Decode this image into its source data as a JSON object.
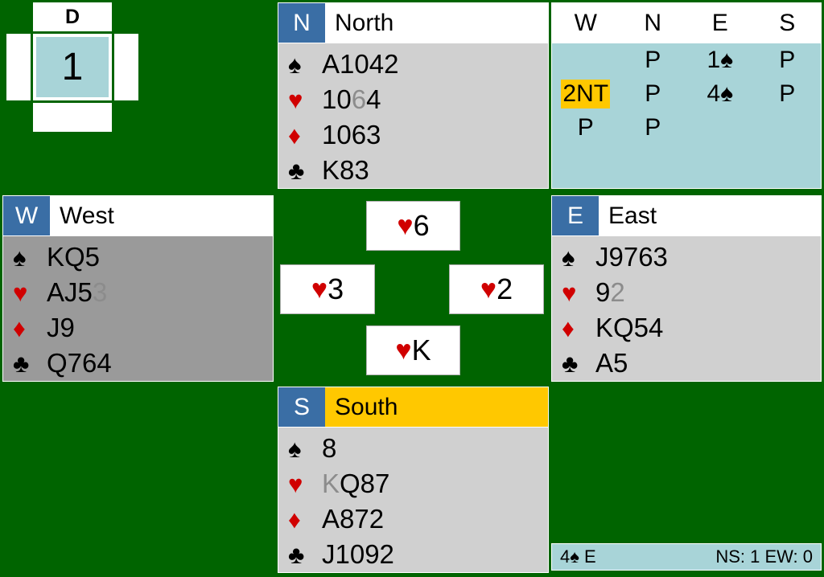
{
  "board": {
    "number": "1",
    "dealer_label": "D",
    "dealer_position": "north",
    "vulnerable": "none",
    "west_label": "",
    "east_label": "",
    "south_label": ""
  },
  "hands": {
    "north": {
      "direction": "N",
      "name": "North",
      "highlight": false,
      "active": false,
      "suits": [
        {
          "symbol": "♠",
          "color": "black",
          "cards": "A1042",
          "played_suffix": ""
        },
        {
          "symbol": "♥",
          "color": "red",
          "cards": "10",
          "played_mid": "6",
          "cards_tail": "4"
        },
        {
          "symbol": "♦",
          "color": "red",
          "cards": "1063",
          "played_suffix": ""
        },
        {
          "symbol": "♣",
          "color": "black",
          "cards": "K83",
          "played_suffix": ""
        }
      ]
    },
    "west": {
      "direction": "W",
      "name": "West",
      "highlight": false,
      "active": true,
      "suits": [
        {
          "symbol": "♠",
          "color": "black",
          "cards": "KQ5",
          "played_suffix": ""
        },
        {
          "symbol": "♥",
          "color": "red",
          "cards": "AJ5",
          "played_suffix": "3"
        },
        {
          "symbol": "♦",
          "color": "red",
          "cards": "J9",
          "played_suffix": ""
        },
        {
          "symbol": "♣",
          "color": "black",
          "cards": "Q764",
          "played_suffix": ""
        }
      ]
    },
    "east": {
      "direction": "E",
      "name": "East",
      "highlight": false,
      "active": false,
      "suits": [
        {
          "symbol": "♠",
          "color": "black",
          "cards": "J9763",
          "played_suffix": ""
        },
        {
          "symbol": "♥",
          "color": "red",
          "cards": "9",
          "played_suffix": "2"
        },
        {
          "symbol": "♦",
          "color": "red",
          "cards": "KQ54",
          "played_suffix": ""
        },
        {
          "symbol": "♣",
          "color": "black",
          "cards": "A5",
          "played_suffix": ""
        }
      ]
    },
    "south": {
      "direction": "S",
      "name": "South",
      "highlight": true,
      "active": false,
      "suits": [
        {
          "symbol": "♠",
          "color": "black",
          "cards": "8",
          "played_suffix": ""
        },
        {
          "symbol": "♥",
          "color": "red",
          "played_prefix": "K",
          "cards": "Q87"
        },
        {
          "symbol": "♦",
          "color": "red",
          "cards": "A872",
          "played_suffix": ""
        },
        {
          "symbol": "♣",
          "color": "black",
          "cards": "J1092",
          "played_suffix": ""
        }
      ]
    }
  },
  "bidding": {
    "headers": [
      "W",
      "N",
      "E",
      "S"
    ],
    "rows": [
      [
        {
          "text": "",
          "suit": "",
          "current": false
        },
        {
          "text": "P",
          "suit": "",
          "current": false
        },
        {
          "text": "1",
          "suit": "♠",
          "current": false
        },
        {
          "text": "P",
          "suit": "",
          "current": false
        }
      ],
      [
        {
          "text": "2NT",
          "suit": "",
          "current": true
        },
        {
          "text": "P",
          "suit": "",
          "current": false
        },
        {
          "text": "4",
          "suit": "♠",
          "current": false
        },
        {
          "text": "P",
          "suit": "",
          "current": false
        }
      ],
      [
        {
          "text": "P",
          "suit": "",
          "current": false
        },
        {
          "text": "P",
          "suit": "",
          "current": false
        },
        {
          "text": "",
          "suit": "",
          "current": false
        },
        {
          "text": "",
          "suit": "",
          "current": false
        }
      ]
    ]
  },
  "trick": {
    "north": {
      "suit": "♥",
      "color": "red",
      "rank": "6"
    },
    "west": {
      "suit": "♥",
      "color": "red",
      "rank": "3"
    },
    "east": {
      "suit": "♥",
      "color": "red",
      "rank": "2"
    },
    "south": {
      "suit": "♥",
      "color": "red",
      "rank": "K"
    }
  },
  "status": {
    "contract_level": "4",
    "contract_suit": "♠",
    "declarer": "E",
    "tricks": "NS: 1 EW: 0"
  },
  "colors": {
    "table_green": "#006400",
    "panel_gray": "#d0d0d0",
    "active_gray": "#9a9a9a",
    "badge_blue": "#3a6ea5",
    "highlight_yellow": "#ffc800",
    "bidding_teal": "#a8d4d8",
    "suit_red": "#d00000",
    "played_gray": "#8c8c8c"
  }
}
